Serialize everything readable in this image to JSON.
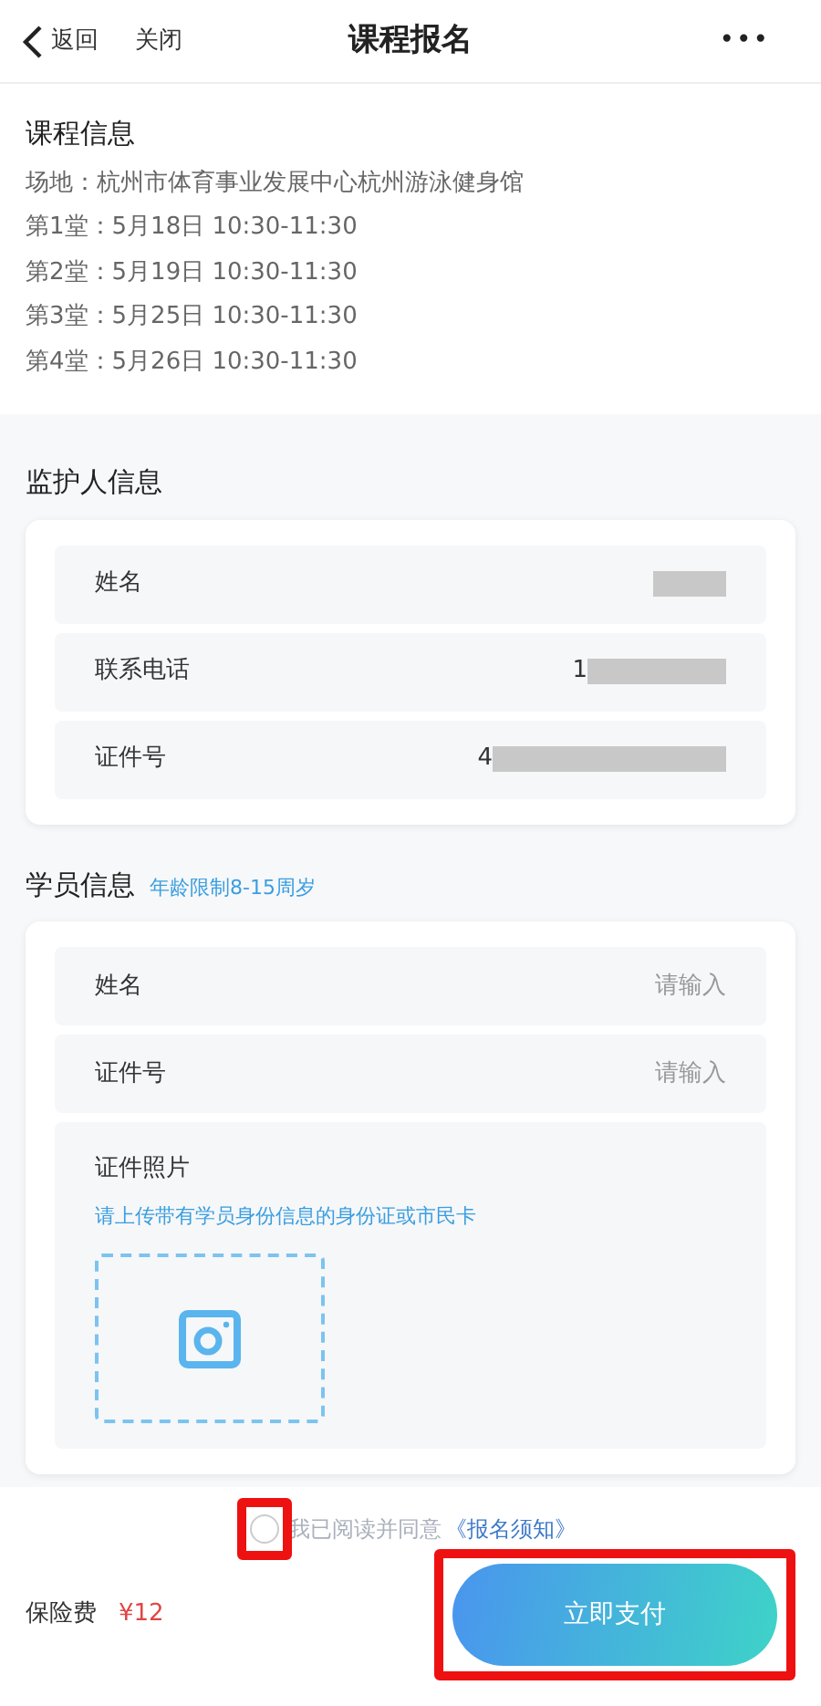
{
  "nav": {
    "back": "返回",
    "close": "关闭",
    "title": "课程报名",
    "more": "•••"
  },
  "course_info": {
    "title": "课程信息",
    "lines": [
      "场地：杭州市体育事业发展中心杭州游泳健身馆",
      "第1堂：5月18日 10:30-11:30",
      "第2堂：5月19日 10:30-11:30",
      "第3堂：5月25日 10:30-11:30",
      "第4堂：5月26日 10:30-11:30"
    ]
  },
  "guardian": {
    "title": "监护人信息",
    "fields": [
      {
        "label": "姓名",
        "redacted": true
      },
      {
        "label": "联系电话",
        "value": "1",
        "redacted": true
      },
      {
        "label": "证件号",
        "value": "4",
        "redacted": true
      }
    ]
  },
  "student": {
    "title": "学员信息",
    "note": "年龄限制8-15周岁",
    "fields": [
      {
        "label": "姓名",
        "placeholder": "请输入"
      },
      {
        "label": "证件号",
        "placeholder": "请输入"
      }
    ],
    "photo": {
      "label": "证件照片",
      "hint": "请上传带有学员身份信息的身份证或市民卡"
    }
  },
  "agreement": {
    "checked": false,
    "highlighted": true,
    "text": "我已阅读并同意",
    "link": "《报名须知》"
  },
  "footer": {
    "fee_label": "保险费",
    "fee": "¥12",
    "pay_button": {
      "label": "立即支付",
      "highlighted": true
    }
  }
}
